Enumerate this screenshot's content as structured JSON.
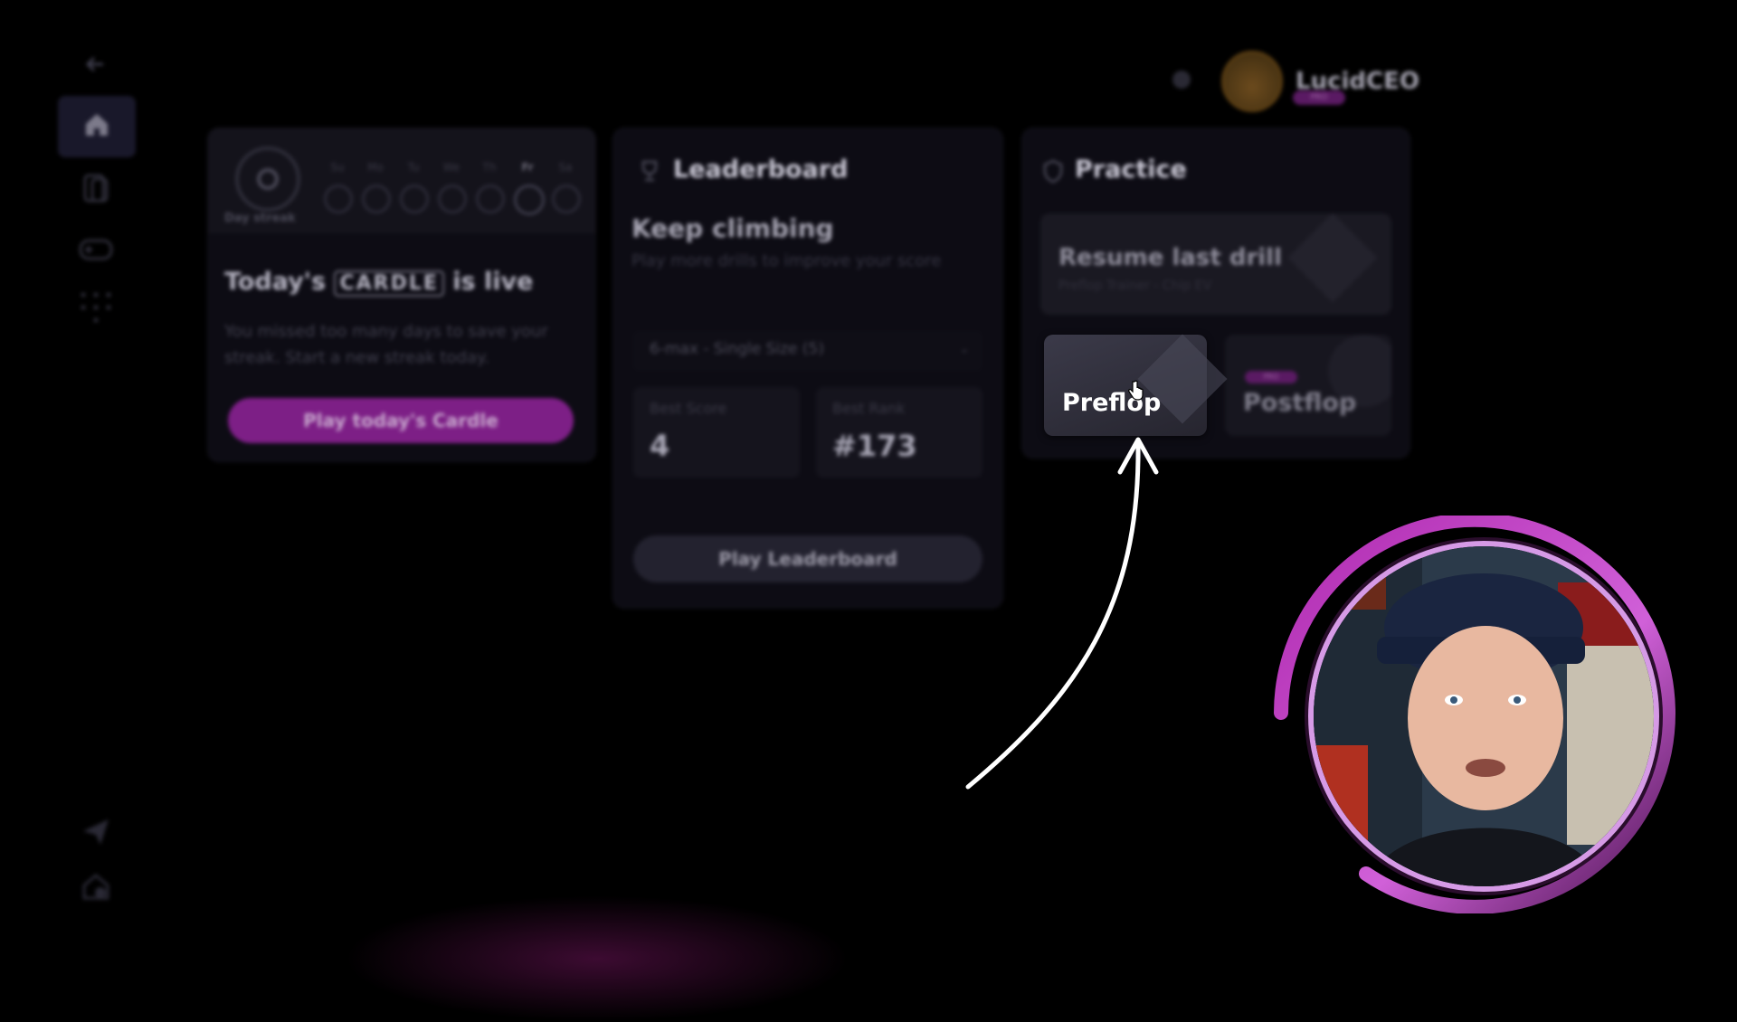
{
  "user": {
    "name": "LucidCEO",
    "badge": "PRO"
  },
  "streak": {
    "label": "Day streak",
    "days": [
      "Su",
      "Mo",
      "Tu",
      "We",
      "Th",
      "Fr",
      "Sa"
    ],
    "active_day": "Fr"
  },
  "cardle": {
    "title_prefix": "Today's",
    "title_brand": "CARDLE",
    "title_suffix": "is live",
    "desc": "You missed too many days to save your streak. Start a new streak today.",
    "button": "Play today's Cardle"
  },
  "leaderboard": {
    "title": "Leaderboard",
    "headline": "Keep climbing",
    "desc": "Play more drills to improve your score",
    "select_value": "6-max - Single Size (5)",
    "best_score_label": "Best Score",
    "best_score_value": "4",
    "best_rank_label": "Best Rank",
    "best_rank_value": "#173",
    "button": "Play Leaderboard"
  },
  "practice": {
    "title": "Practice",
    "resume_title": "Resume last drill",
    "resume_sub": "Preflop Trainer - Chip EV",
    "tile_preflop": "Preflop",
    "tile_postflop": "Postflop",
    "postflop_badge": "PRO"
  },
  "colors": {
    "accent_purple": "#7d1f86",
    "ring": "#d69ae6",
    "background": "#000000"
  },
  "icons": [
    "back-arrow-icon",
    "home-icon",
    "cards-icon",
    "gamepad-icon",
    "grid-icon",
    "send-icon",
    "settings-icon",
    "cursor-hand-icon"
  ]
}
